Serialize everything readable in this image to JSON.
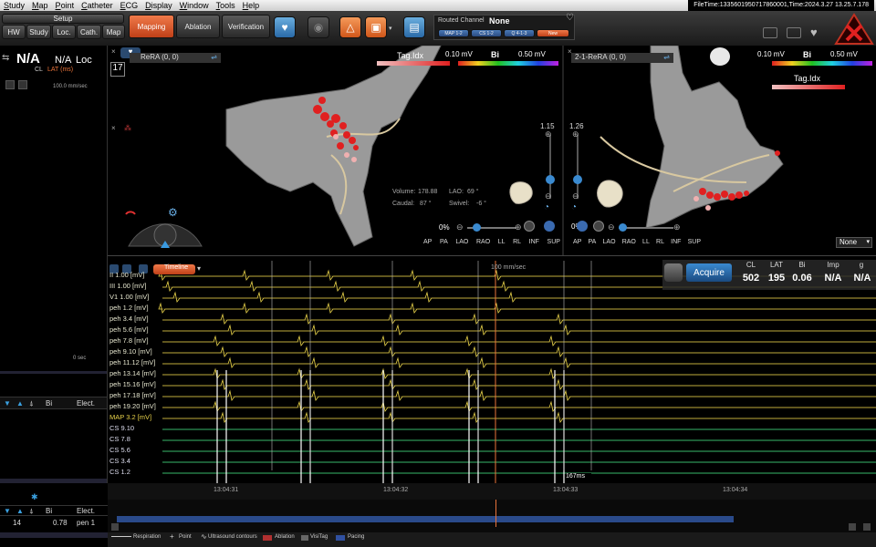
{
  "menu": [
    "Study",
    "Map",
    "Point",
    "Catheter",
    "ECG",
    "Display",
    "Window",
    "Tools",
    "Help"
  ],
  "file_time": "FileTime:1335601950717860001,Time:2024.3.27 13.25.7.178",
  "toolbar": {
    "setup_label": "Setup",
    "setup_tabs": [
      "HW",
      "Study",
      "Loc.",
      "Cath.",
      "Map"
    ],
    "mode_tabs": [
      "Mapping",
      "Ablation",
      "Verification"
    ],
    "routed_channel_label": "Routed Channel",
    "routed_channel_value": "None",
    "route_buttons": [
      "MAP 1-2",
      "CS 1-2",
      "Q 4-1-3",
      "New"
    ]
  },
  "left_panel": {
    "cl_value": "N/A",
    "cl_label": "CL",
    "lat_value": "N/A",
    "lat_label": "LAT (ms)",
    "loc_value": "Loc",
    "speed": "100.0 mm/sec",
    "zero_sec": "0 sec",
    "table_headers": [
      "Bi",
      "Elect."
    ],
    "bottom_headers": [
      "Bi",
      "Elect."
    ],
    "bottom_row": {
      "index": "14",
      "value": "0.78",
      "elect": "pen 1"
    }
  },
  "map_left": {
    "title": "ReRA (0, 0)",
    "frame_number": "17",
    "scale_min": "0.10 mV",
    "scale_mid": "Bi",
    "scale_max": "0.50 mV",
    "tag_label": "Tag.Idx",
    "zoom_value": "1.15",
    "volume_label": "Volume:",
    "volume_value": "178.88",
    "lao_label": "LAO:",
    "lao_value": "69 °",
    "caudal_label": "Caudal:",
    "caudal_value": "87 °",
    "swivel_label": "Swivel:",
    "swivel_value": "-6 °",
    "opacity": "0%",
    "views": [
      "AP",
      "PA",
      "LAO",
      "RAO",
      "LL",
      "RL",
      "INF",
      "SUP"
    ]
  },
  "map_right": {
    "title": "2-1-ReRA (0, 0)",
    "scale_min": "0.10 mV",
    "scale_mid": "Bi",
    "scale_max": "0.50 mV",
    "tag_label": "Tag.Idx",
    "zoom_value": "1.26",
    "opacity": "0%",
    "views": [
      "AP",
      "PA",
      "LAO",
      "RAO",
      "LL",
      "RL",
      "INF",
      "SUP"
    ],
    "dropdown": "None"
  },
  "signals": {
    "timeline_label": "Timeline",
    "speed": "100 mm/sec",
    "acquire_label": "Acquire",
    "stat_headers": [
      "CL",
      "LAT",
      "Bi",
      "Imp",
      "g"
    ],
    "stat_values": [
      "502",
      "195",
      "0.06",
      "N/A",
      "N/A"
    ],
    "channels": [
      "II 1.00 [mV]",
      "III 1.00 [mV]",
      "V1 1.00 [mV]",
      "peh 1.2 [mV]",
      "peh 3.4 [mV]",
      "peh 5.6 [mV]",
      "peh 7.8 [mV]",
      "peh 9.10 [mV]",
      "peh 11.12 [mV]",
      "peh 13.14 [mV]",
      "peh 15.16 [mV]",
      "peh 17.18 [mV]",
      "peh 19.20 [mV]",
      "MAP 3.2 [mV]",
      "CS 9.10",
      "CS 7.8",
      "CS 5.6",
      "CS 3.4",
      "CS 1.2"
    ],
    "caliper": "167ms",
    "time_ticks": [
      "13:04:31",
      "13:04:32",
      "13:04:33",
      "13:04:34"
    ]
  },
  "legend": [
    "Respiration",
    "Point",
    "Ultrasound contours",
    "Ablation",
    "VisiTag",
    "Pacing"
  ],
  "colors": {
    "accent": "#e8733a",
    "signal": "#e8d24a",
    "cs_green": "#38b86a",
    "ablation": "#b03030",
    "pacing": "#3050a0"
  }
}
